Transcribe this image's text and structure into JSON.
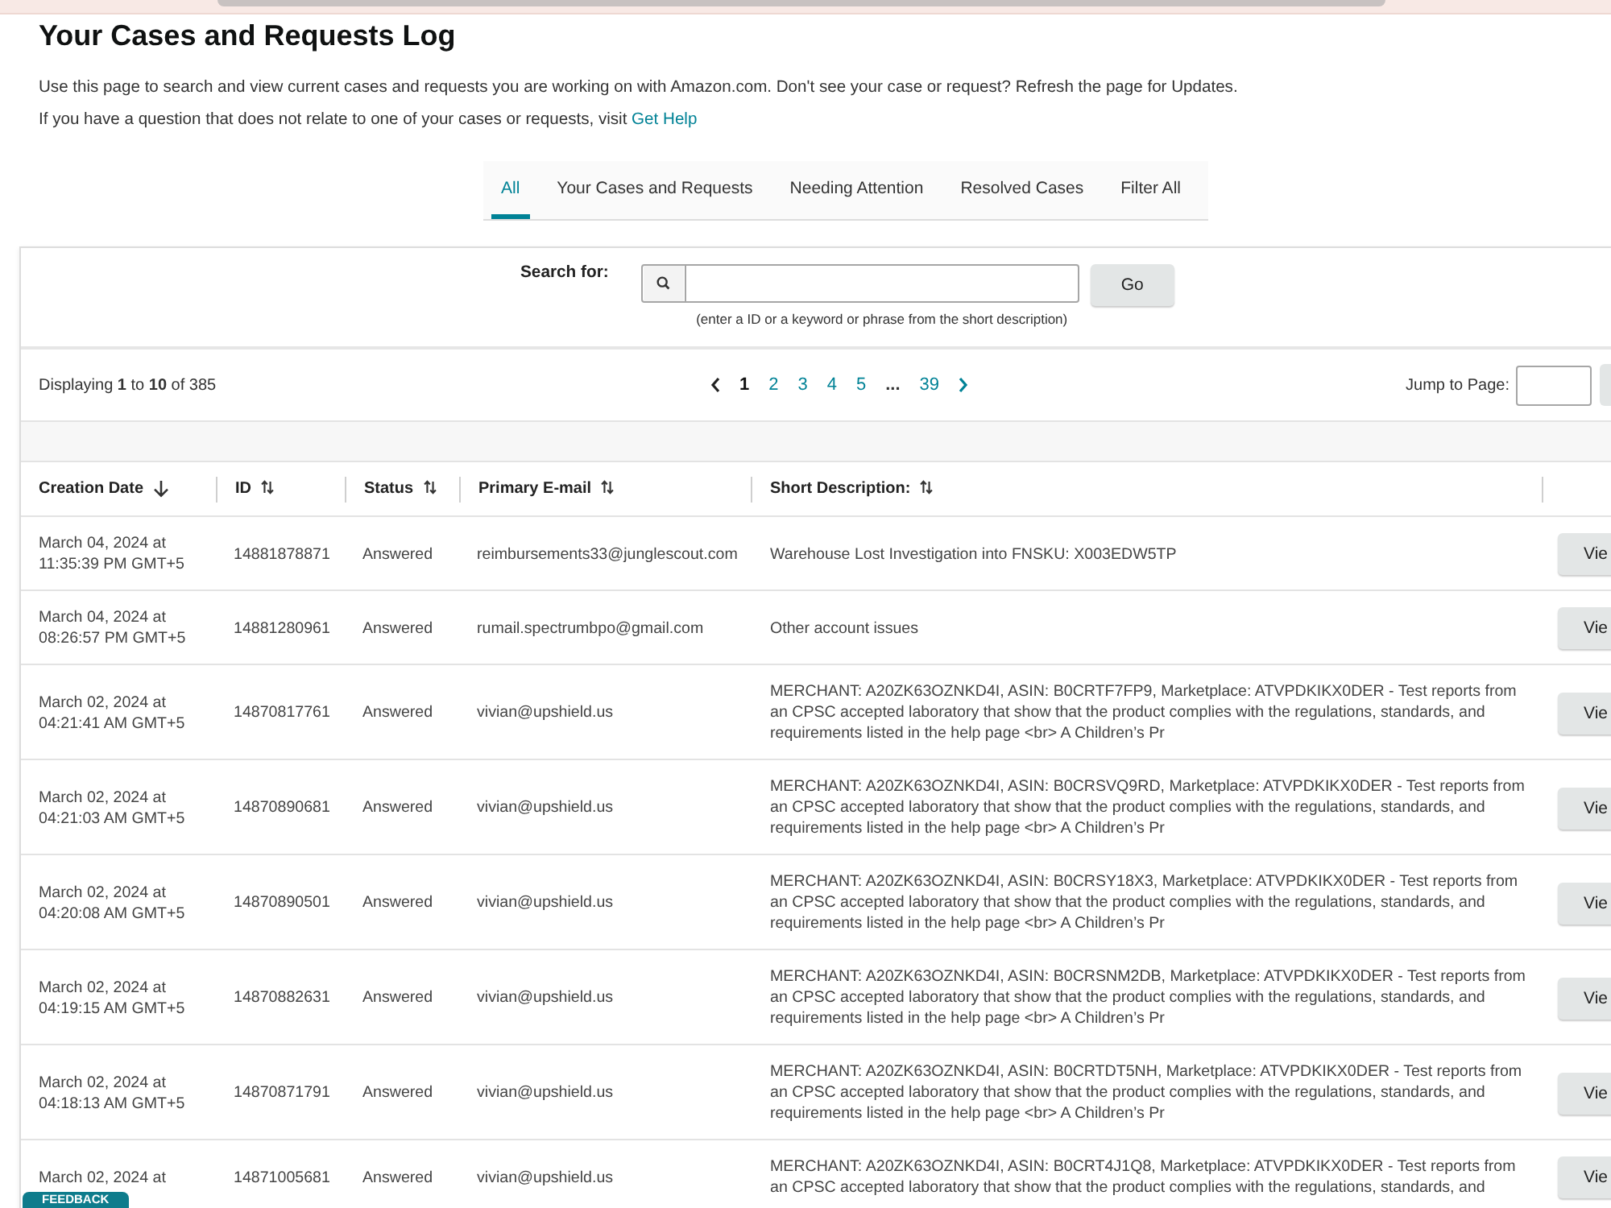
{
  "page": {
    "title": "Your Cases and Requests Log",
    "intro": "Use this page to search and view current cases and requests you are working on with Amazon.com. Don't see your case or request? Refresh the page for Updates.",
    "help_text": "If you have a question that does not relate to one of your cases or requests, visit",
    "help_link": "Get Help"
  },
  "tabs": [
    {
      "label": "All",
      "selected": true
    },
    {
      "label": "Your Cases and Requests",
      "selected": false
    },
    {
      "label": "Needing Attention",
      "selected": false
    },
    {
      "label": "Resolved Cases",
      "selected": false
    },
    {
      "label": "Filter All",
      "selected": false
    }
  ],
  "search": {
    "label": "Search for:",
    "hint": "(enter a ID or a keyword or phrase from the short description)",
    "button": "Go"
  },
  "pagination": {
    "summary": "Displaying **1** to **10** of 385",
    "pages": [
      {
        "kind": "page",
        "label": "1",
        "selected": true
      },
      {
        "kind": "page",
        "label": "2",
        "selected": false
      },
      {
        "kind": "page",
        "label": "3",
        "selected": false
      },
      {
        "kind": "page",
        "label": "4",
        "selected": false
      },
      {
        "kind": "page",
        "label": "5",
        "selected": false
      },
      {
        "kind": "ellipsis",
        "label": "...",
        "selected": false
      },
      {
        "kind": "page",
        "label": "39",
        "selected": false
      }
    ],
    "jump_label": "Jump to Page:"
  },
  "table": {
    "columns": [
      {
        "label": "Creation Date",
        "sorted": true
      },
      {
        "label": "ID",
        "sorted": false
      },
      {
        "label": "Status",
        "sorted": false
      },
      {
        "label": "Primary E-mail",
        "sorted": false
      },
      {
        "label": "Short Description:",
        "sorted": false
      }
    ],
    "rows": [
      {
        "date": "March 04, 2024 at 11:35:39 PM GMT+5",
        "id": "14881878871",
        "status": "Answered",
        "email": "reimbursements33@junglescout.com",
        "description": "Warehouse Lost Investigation into FNSKU: X003EDW5TP",
        "action": "Vie"
      },
      {
        "date": "March 04, 2024 at 08:26:57 PM GMT+5",
        "id": "14881280961",
        "status": "Answered",
        "email": "rumail.spectrumbpo@gmail.com",
        "description": "Other account issues",
        "action": "Vie"
      },
      {
        "date": "March 02, 2024 at 04:21:41 AM GMT+5",
        "id": "14870817761",
        "status": "Answered",
        "email": "vivian@upshield.us",
        "description": "MERCHANT: A20ZK63OZNKD4I, ASIN: B0CRTF7FP9, Marketplace: ATVPDKIKX0DER - Test reports from an CPSC accepted laboratory that show that the product complies with the regulations, standards, and requirements listed in the help page <br> A Children’s Pr",
        "action": "Vie"
      },
      {
        "date": "March 02, 2024 at 04:21:03 AM GMT+5",
        "id": "14870890681",
        "status": "Answered",
        "email": "vivian@upshield.us",
        "description": "MERCHANT: A20ZK63OZNKD4I, ASIN: B0CRSVQ9RD, Marketplace: ATVPDKIKX0DER - Test reports from an CPSC accepted laboratory that show that the product complies with the regulations, standards, and requirements listed in the help page <br> A Children’s Pr",
        "action": "Vie"
      },
      {
        "date": "March 02, 2024 at 04:20:08 AM GMT+5",
        "id": "14870890501",
        "status": "Answered",
        "email": "vivian@upshield.us",
        "description": "MERCHANT: A20ZK63OZNKD4I, ASIN: B0CRSY18X3, Marketplace: ATVPDKIKX0DER - Test reports from an CPSC accepted laboratory that show that the product complies with the regulations, standards, and requirements listed in the help page <br> A Children’s Pr",
        "action": "Vie"
      },
      {
        "date": "March 02, 2024 at 04:19:15 AM GMT+5",
        "id": "14870882631",
        "status": "Answered",
        "email": "vivian@upshield.us",
        "description": "MERCHANT: A20ZK63OZNKD4I, ASIN: B0CRSNM2DB, Marketplace: ATVPDKIKX0DER - Test reports from an CPSC accepted laboratory that show that the product complies with the regulations, standards, and requirements listed in the help page <br> A Children’s Pr",
        "action": "Vie"
      },
      {
        "date": "March 02, 2024 at 04:18:13 AM GMT+5",
        "id": "14870871791",
        "status": "Answered",
        "email": "vivian@upshield.us",
        "description": "MERCHANT: A20ZK63OZNKD4I, ASIN: B0CRTDT5NH, Marketplace: ATVPDKIKX0DER - Test reports from an CPSC accepted laboratory that show that the product complies with the regulations, standards, and requirements listed in the help page <br> A Children’s Pr",
        "action": "Vie"
      },
      {
        "date": "March 02, 2024 at",
        "id": "14871005681",
        "status": "Answered",
        "email": "vivian@upshield.us",
        "description": "MERCHANT: A20ZK63OZNKD4I, ASIN: B0CRT4J1Q8, Marketplace: ATVPDKIKX0DER - Test reports from an CPSC accepted laboratory that show that the product complies with the regulations, standards, and",
        "action": "Vie"
      }
    ]
  },
  "feedback": {
    "label": "FEEDBACK"
  }
}
